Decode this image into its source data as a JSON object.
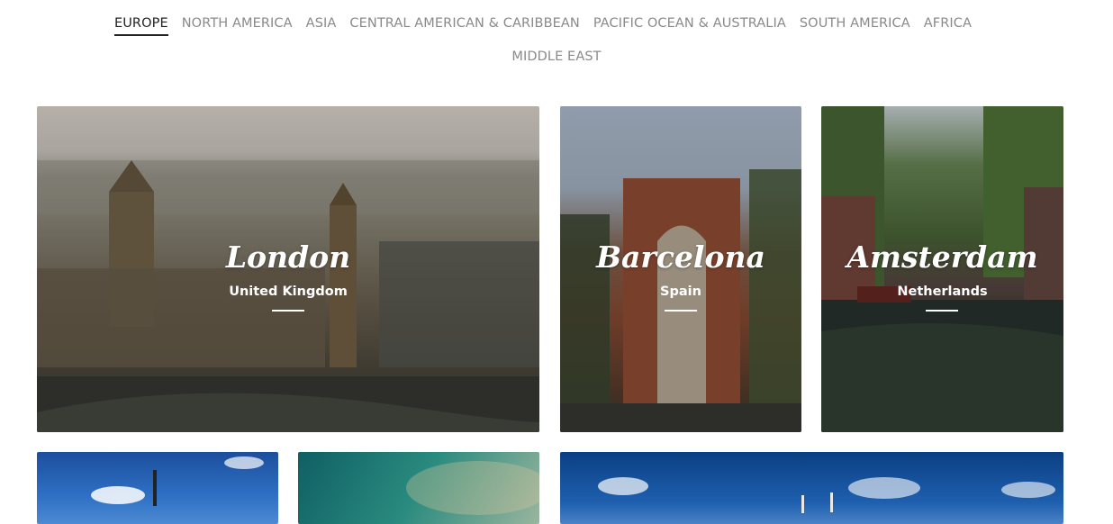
{
  "tabs": {
    "row1": [
      "EUROPE",
      "NORTH AMERICA",
      "ASIA",
      "CENTRAL AMERICAN & CARIBBEAN",
      "PACIFIC OCEAN & AUSTRALIA",
      "SOUTH AMERICA",
      "AFRICA"
    ],
    "row2": [
      "MIDDLE EAST"
    ],
    "active": "EUROPE"
  },
  "cards": [
    {
      "city": "London",
      "country": "United Kingdom"
    },
    {
      "city": "Barcelona",
      "country": "Spain"
    },
    {
      "city": "Amsterdam",
      "country": "Netherlands"
    }
  ],
  "colors": {
    "active_tab": "#222222",
    "inactive_tab": "#8a8a8a",
    "card_text": "#ffffff"
  }
}
